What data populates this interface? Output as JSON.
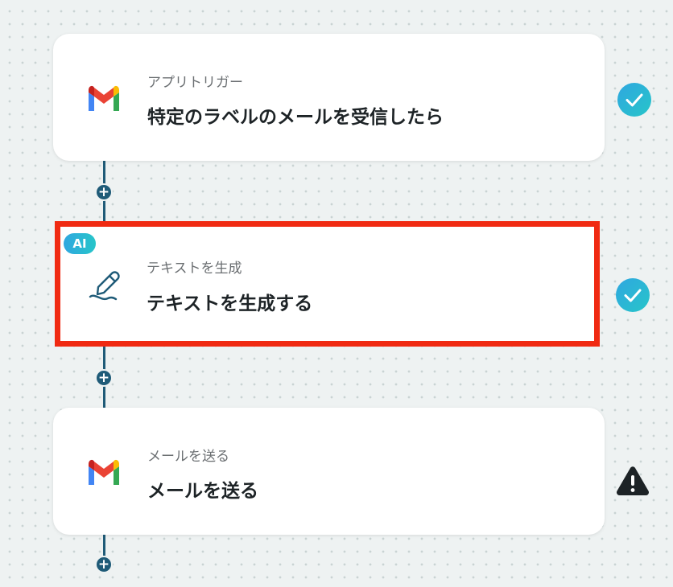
{
  "flow": {
    "steps": [
      {
        "ai_badge": "",
        "subtitle": "アプリトリガー",
        "title": "特定のラベルのメールを受信したら",
        "app_icon": "gmail-icon",
        "status": "completed",
        "status_icon": "check-circle-icon"
      },
      {
        "ai_badge": "AI",
        "subtitle": "テキストを生成",
        "title": "テキストを生成する",
        "app_icon": "pen-icon",
        "status": "completed",
        "status_icon": "check-circle-icon",
        "selected": true
      },
      {
        "ai_badge": "",
        "subtitle": "メールを送る",
        "title": "メールを送る",
        "app_icon": "gmail-icon",
        "status": "warning",
        "status_icon": "warning-icon"
      }
    ],
    "add_step_label": "+"
  },
  "colors": {
    "connector": "#1f5b78",
    "selection_border": "#f02a12",
    "check_gradient_start": "#2fa7e0",
    "check_gradient_end": "#27c5c9",
    "warning": "#1d2326"
  }
}
